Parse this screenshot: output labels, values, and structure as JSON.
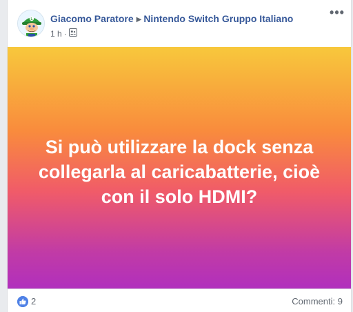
{
  "post": {
    "author": "Giacomo Paratore",
    "group": "Nintendo Switch Gruppo Italiano",
    "time": "1 h",
    "separator": "·",
    "privacy_icon": "group-privacy-icon",
    "more_icon": "more-options-icon",
    "text": "Si può utilizzare la dock senza collegarla al caricabatterie, cioè con il solo HDMI?",
    "like_count": "2",
    "comments_label": "Commenti:",
    "comments_count": "9"
  },
  "colors": {
    "link": "#365899",
    "meta": "#606770",
    "gradient_top": "#f8c83c",
    "gradient_bottom": "#b12fbd",
    "like_blue": "#4f81e6"
  }
}
